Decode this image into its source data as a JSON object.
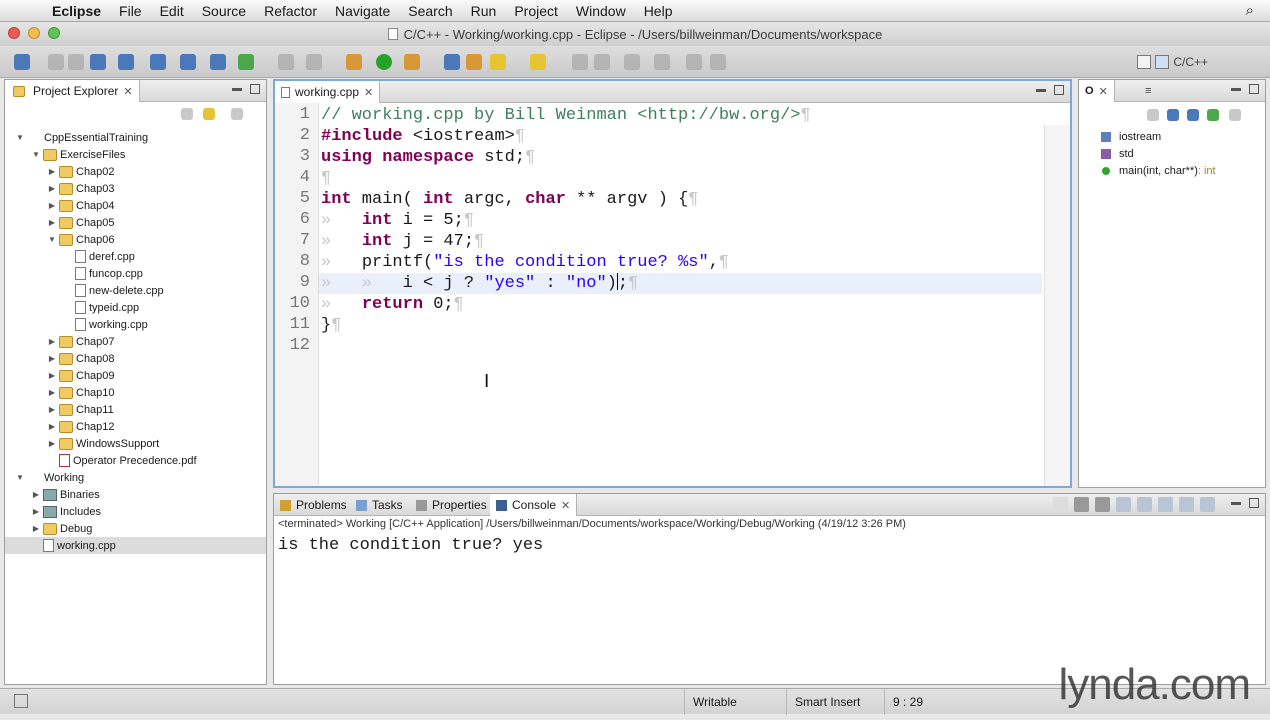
{
  "menubar": {
    "app_name": "Eclipse",
    "items": [
      "File",
      "Edit",
      "Source",
      "Refactor",
      "Navigate",
      "Search",
      "Run",
      "Project",
      "Window",
      "Help"
    ]
  },
  "window": {
    "title": "C/C++ - Working/working.cpp - Eclipse - /Users/billweinman/Documents/workspace"
  },
  "perspective": {
    "label": "C/C++"
  },
  "explorer": {
    "tab_label": "Project Explorer",
    "tree": [
      {
        "label": "CppEssentialTraining",
        "type": "project",
        "depth": 0,
        "expanded": true
      },
      {
        "label": "ExerciseFiles",
        "type": "folder",
        "depth": 1,
        "expanded": true
      },
      {
        "label": "Chap02",
        "type": "folder",
        "depth": 2
      },
      {
        "label": "Chap03",
        "type": "folder",
        "depth": 2
      },
      {
        "label": "Chap04",
        "type": "folder",
        "depth": 2
      },
      {
        "label": "Chap05",
        "type": "folder",
        "depth": 2
      },
      {
        "label": "Chap06",
        "type": "folder",
        "depth": 2,
        "expanded": true
      },
      {
        "label": "deref.cpp",
        "type": "file",
        "depth": 3
      },
      {
        "label": "funcop.cpp",
        "type": "file",
        "depth": 3
      },
      {
        "label": "new-delete.cpp",
        "type": "file",
        "depth": 3
      },
      {
        "label": "typeid.cpp",
        "type": "file",
        "depth": 3
      },
      {
        "label": "working.cpp",
        "type": "file",
        "depth": 3
      },
      {
        "label": "Chap07",
        "type": "folder",
        "depth": 2
      },
      {
        "label": "Chap08",
        "type": "folder",
        "depth": 2
      },
      {
        "label": "Chap09",
        "type": "folder",
        "depth": 2
      },
      {
        "label": "Chap10",
        "type": "folder",
        "depth": 2
      },
      {
        "label": "Chap11",
        "type": "folder",
        "depth": 2
      },
      {
        "label": "Chap12",
        "type": "folder",
        "depth": 2
      },
      {
        "label": "WindowsSupport",
        "type": "folder",
        "depth": 2
      },
      {
        "label": "Operator Precedence.pdf",
        "type": "pdf",
        "depth": 2
      },
      {
        "label": "Working",
        "type": "project",
        "depth": 0,
        "expanded": true
      },
      {
        "label": "Binaries",
        "type": "bin",
        "depth": 1
      },
      {
        "label": "Includes",
        "type": "bin",
        "depth": 1
      },
      {
        "label": "Debug",
        "type": "folder",
        "depth": 1
      },
      {
        "label": "working.cpp",
        "type": "file",
        "depth": 1,
        "selected": true
      }
    ]
  },
  "editor": {
    "tab_label": "working.cpp",
    "line_numbers": [
      "1",
      "2",
      "3",
      "4",
      "5",
      "6",
      "7",
      "8",
      "9",
      "10",
      "11",
      "12"
    ],
    "current_line": 9,
    "lines": [
      "// working.cpp by Bill Weinman <http://bw.org/>",
      "#include <iostream>",
      "using namespace std;",
      "",
      "int main( int argc, char ** argv ) {",
      "int i = 5;",
      "int j = 47;",
      "printf(\"is the condition true? %s\",",
      "i < j ? \"yes\" : \"no\");",
      "return 0;",
      "}",
      ""
    ]
  },
  "outline": {
    "items": [
      {
        "label": "iostream",
        "kind": "include"
      },
      {
        "label": "std",
        "kind": "namespace"
      },
      {
        "label": "main(int, char**)",
        "type": " : int",
        "kind": "function"
      }
    ]
  },
  "bottom": {
    "tabs": [
      "Problems",
      "Tasks",
      "Properties",
      "Console"
    ],
    "active_tab": "Console",
    "terminated": "<terminated> Working [C/C++ Application] /Users/billweinman/Documents/workspace/Working/Debug/Working (4/19/12 3:26 PM)",
    "output": "is the condition true? yes"
  },
  "status": {
    "writable": "Writable",
    "insert_mode": "Smart Insert",
    "position": "9 : 29"
  },
  "watermark": "lynda.com",
  "colors": {
    "keyword": "#7f0055",
    "comment": "#3f7f5f",
    "string": "#2a00ff",
    "focus_border": "#7ea7da"
  }
}
